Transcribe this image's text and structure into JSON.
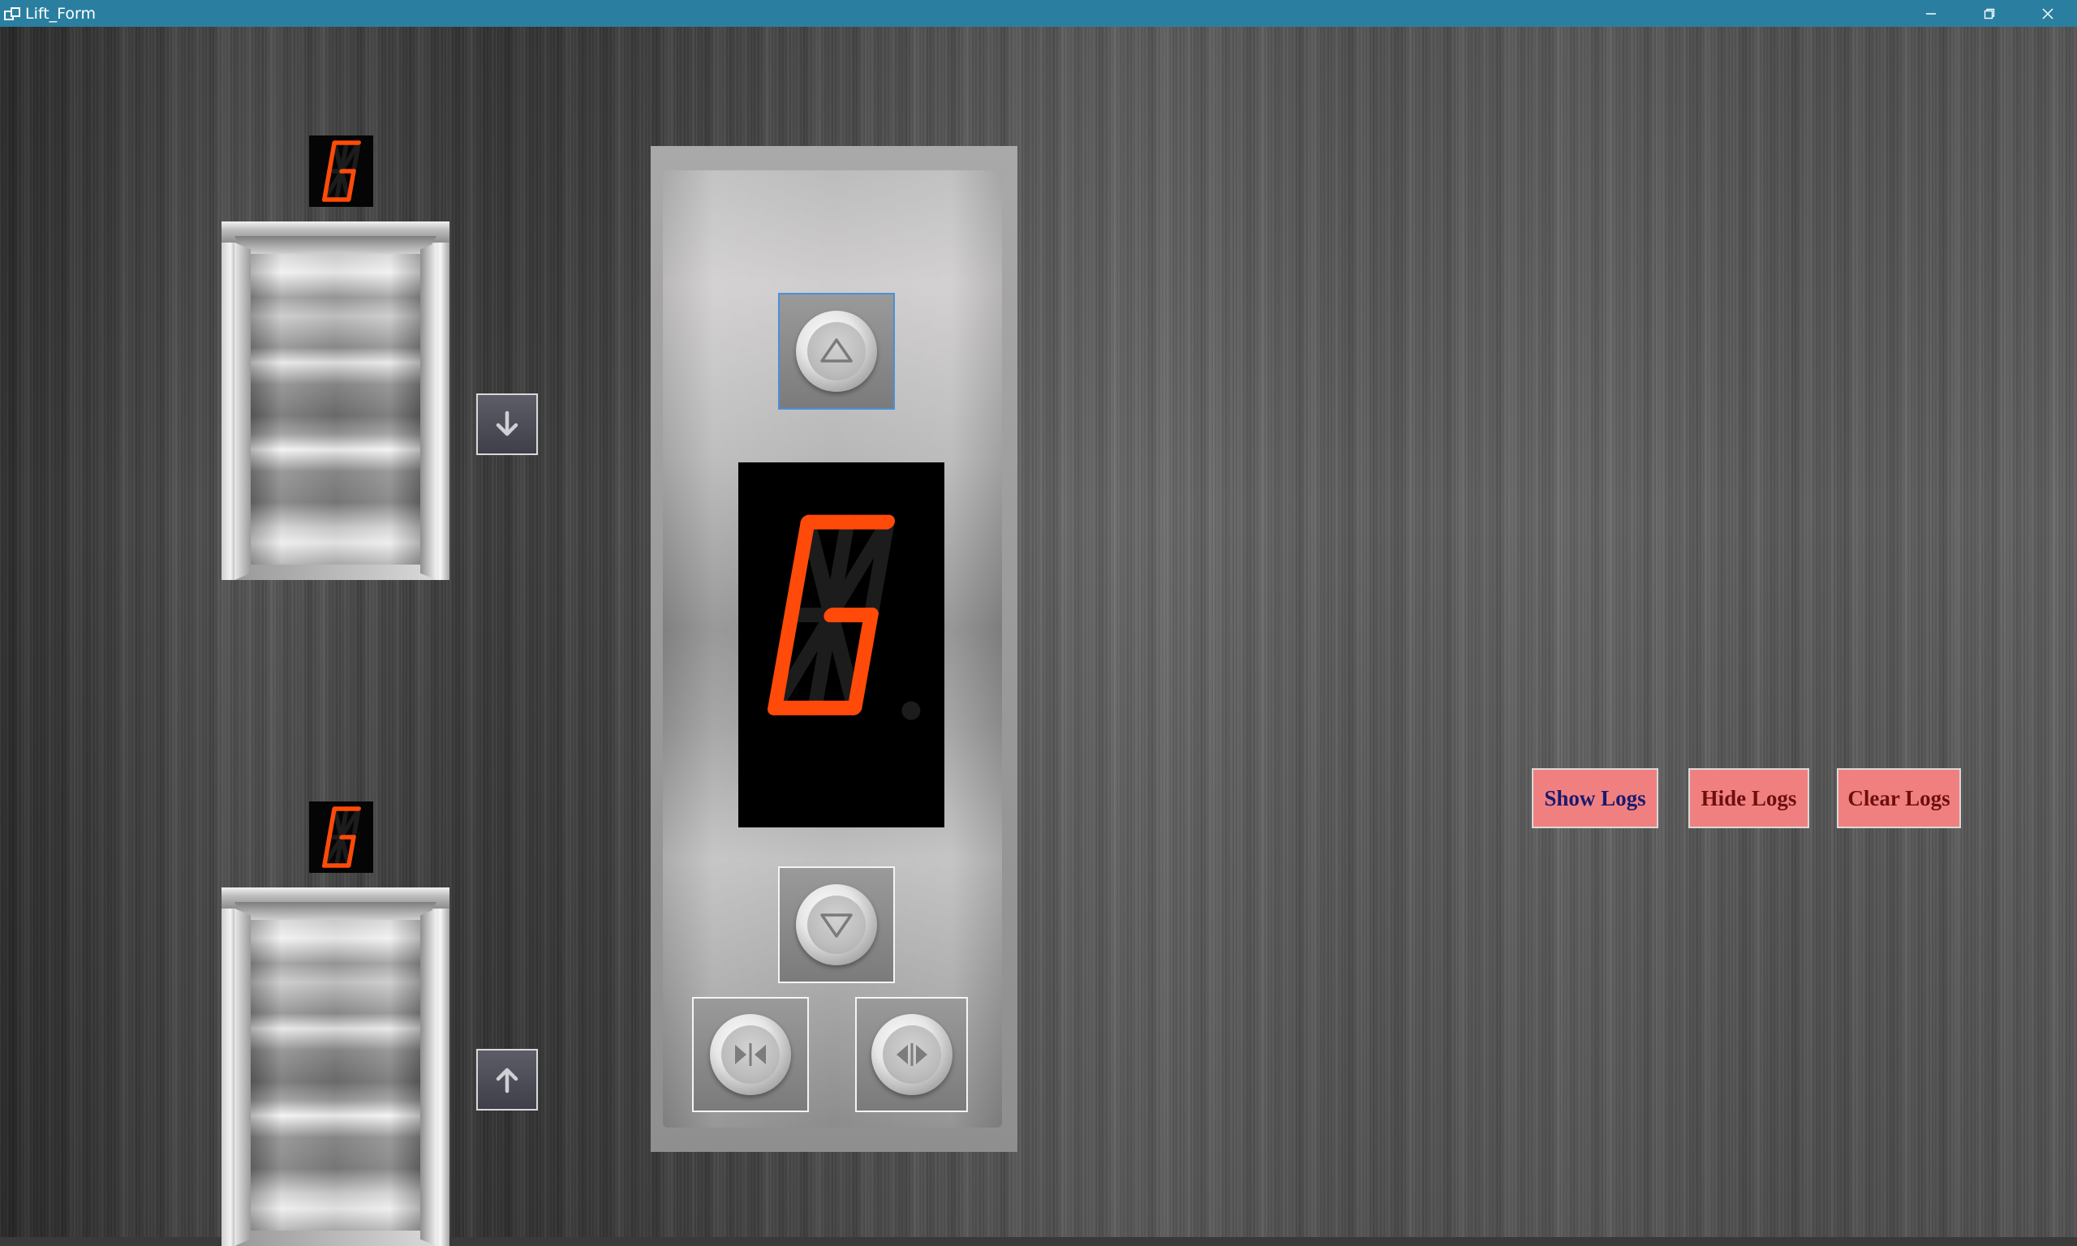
{
  "window": {
    "title": "Lift_Form",
    "controls": {
      "minimize": "minimize-icon",
      "restore": "restore-icon",
      "close": "close-icon"
    }
  },
  "floors": {
    "upper": {
      "display_char": "G",
      "hall_button": "down-arrow-icon"
    },
    "lower": {
      "display_char": "G",
      "hall_button": "up-arrow-icon"
    }
  },
  "panel": {
    "display_char": "G",
    "buttons": {
      "up": "up-triangle-icon",
      "down": "down-triangle-icon",
      "close_door": "close-door-icon",
      "open_door": "open-door-icon"
    }
  },
  "logs": {
    "show_label": "Show Logs",
    "hide_label": "Hide Logs",
    "clear_label": "Clear Logs"
  },
  "colors": {
    "titlebar": "#2a7fa0",
    "segment_on": "#ff4a0a",
    "segment_off": "#1c1c1c",
    "log_button_bg": "#f08080",
    "show_logs_text": "#1a1a6e",
    "hide_logs_text": "#6e0f0f",
    "clear_logs_text": "#6e0f0f"
  }
}
